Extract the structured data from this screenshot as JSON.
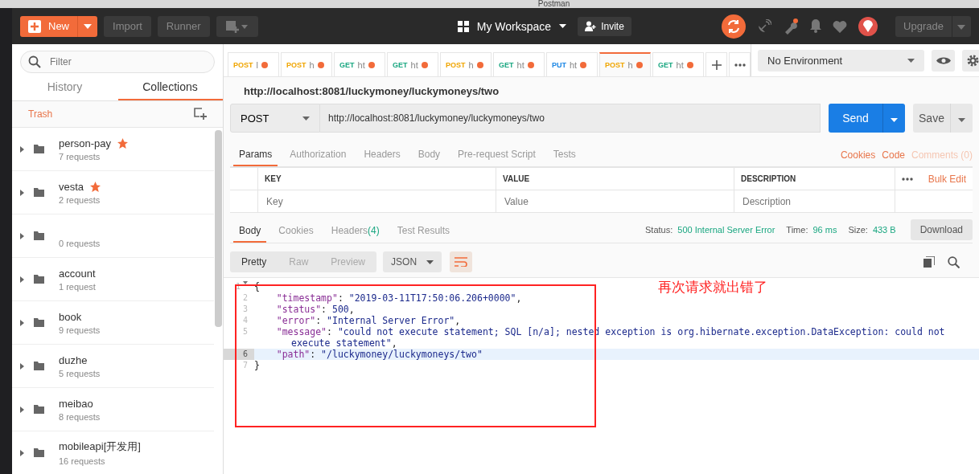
{
  "window": {
    "title": "Postman"
  },
  "header": {
    "new_label": "New",
    "import_label": "Import",
    "runner_label": "Runner",
    "workspace": "My Workspace",
    "invite": "Invite",
    "upgrade": "Upgrade"
  },
  "sidebar": {
    "filter_placeholder": "Filter",
    "tabs": [
      {
        "label": "History",
        "selected": false
      },
      {
        "label": "Collections",
        "selected": true
      }
    ],
    "trash": "Trash",
    "collections": [
      {
        "name": "person-pay",
        "count": "7 requests",
        "starred": true
      },
      {
        "name": "vesta",
        "count": "2 requests",
        "starred": true
      },
      {
        "count": "0 requests",
        "starred": false
      },
      {
        "name": "account",
        "count": "1 request",
        "starred": false
      },
      {
        "name": "book",
        "count": "9 requests",
        "starred": false
      },
      {
        "name": "duzhe",
        "count": "5 requests",
        "starred": false
      },
      {
        "name": "meibao",
        "count": "8 requests",
        "starred": false
      },
      {
        "name": "mobileapi[开发用]",
        "count": "16 requests",
        "starred": false
      }
    ]
  },
  "request_tabs": [
    {
      "method": "POST",
      "title": "l",
      "selected": false,
      "unsaved": true
    },
    {
      "method": "POST",
      "title": "h",
      "selected": false,
      "unsaved": true
    },
    {
      "method": "GET",
      "title": "ht",
      "selected": false,
      "unsaved": true
    },
    {
      "method": "GET",
      "title": "ht",
      "selected": false,
      "unsaved": true
    },
    {
      "method": "POST",
      "title": "h",
      "selected": false,
      "unsaved": true
    },
    {
      "method": "GET",
      "title": "ht",
      "selected": false,
      "unsaved": true
    },
    {
      "method": "PUT",
      "title": "ht",
      "selected": false,
      "unsaved": true
    },
    {
      "method": "POST",
      "title": "h",
      "selected": true,
      "unsaved": true
    },
    {
      "method": "GET",
      "title": "ht",
      "selected": false,
      "unsaved": true
    }
  ],
  "environment": "No Environment",
  "request": {
    "title": "http://localhost:8081/luckymoney/luckymoneys/two",
    "method": "POST",
    "url": "http://localhost:8081/luckymoney/luckymoneys/two",
    "send": "Send",
    "save": "Save"
  },
  "request_sections": [
    {
      "label": "Params",
      "selected": true
    },
    {
      "label": "Authorization",
      "selected": false
    },
    {
      "label": "Headers",
      "selected": false
    },
    {
      "label": "Body",
      "selected": false
    },
    {
      "label": "Pre-request Script",
      "selected": false
    },
    {
      "label": "Tests",
      "selected": false
    }
  ],
  "request_links": [
    {
      "label": "Cookies",
      "disabled": false
    },
    {
      "label": "Code",
      "disabled": false
    },
    {
      "label": "Comments (0)",
      "disabled": true
    }
  ],
  "params_table": {
    "columns": [
      "KEY",
      "VALUE",
      "DESCRIPTION"
    ],
    "bulk_edit": "Bulk Edit",
    "placeholders": [
      "Key",
      "Value",
      "Description"
    ]
  },
  "response_sections": [
    {
      "label": "Body",
      "selected": true
    },
    {
      "label": "Cookies",
      "selected": false
    },
    {
      "label": "Headers",
      "count": "(4)",
      "selected": false
    },
    {
      "label": "Test Results",
      "selected": false
    }
  ],
  "status": {
    "status_label": "Status:",
    "status": "500 Internal Server Error",
    "time_label": "Time:",
    "time": "96 ms",
    "size_label": "Size:",
    "size": "433 B",
    "download": "Download"
  },
  "view_modes": [
    {
      "label": "Pretty",
      "selected": true
    },
    {
      "label": "Raw",
      "selected": false
    },
    {
      "label": "Preview",
      "selected": false
    }
  ],
  "format": "JSON",
  "code_lines": [
    {
      "number": "1",
      "fold": true,
      "highlighted": false,
      "tokens": [
        {
          "kind": "punct",
          "text": "{"
        }
      ]
    },
    {
      "number": "2",
      "fold": false,
      "highlighted": false,
      "tokens": [
        {
          "kind": "key",
          "text": "    \"timestamp\""
        },
        {
          "kind": "punct",
          "text": ": "
        },
        {
          "kind": "string",
          "text": "\"2019-03-11T17:50:06.206+0000\""
        },
        {
          "kind": "punct",
          "text": ","
        }
      ]
    },
    {
      "number": "3",
      "fold": false,
      "highlighted": false,
      "tokens": [
        {
          "kind": "key",
          "text": "    \"status\""
        },
        {
          "kind": "punct",
          "text": ": "
        },
        {
          "kind": "number",
          "text": "500"
        },
        {
          "kind": "punct",
          "text": ","
        }
      ]
    },
    {
      "number": "4",
      "fold": false,
      "highlighted": false,
      "tokens": [
        {
          "kind": "key",
          "text": "    \"error\""
        },
        {
          "kind": "punct",
          "text": ": "
        },
        {
          "kind": "string",
          "text": "\"Internal Server Error\""
        },
        {
          "kind": "punct",
          "text": ","
        }
      ]
    },
    {
      "number": "5",
      "fold": false,
      "highlighted": false,
      "tokens": [
        {
          "kind": "key",
          "text": "    \"message\""
        },
        {
          "kind": "punct",
          "text": ": "
        },
        {
          "kind": "string",
          "text": "\"could not execute statement; SQL [n/a]; nested exception is org.hibernate.exception.DataException: could not execute statement\""
        },
        {
          "kind": "punct",
          "text": ","
        }
      ]
    },
    {
      "number": "6",
      "fold": false,
      "highlighted": true,
      "tokens": [
        {
          "kind": "key",
          "text": "    \"path\""
        },
        {
          "kind": "punct",
          "text": ": "
        },
        {
          "kind": "string",
          "text": "\"/luckymoney/luckymoneys/two\""
        }
      ]
    },
    {
      "number": "7",
      "fold": false,
      "highlighted": false,
      "tokens": [
        {
          "kind": "punct",
          "text": "}"
        }
      ]
    }
  ],
  "annotation": {
    "text": "再次请求就出错了"
  }
}
